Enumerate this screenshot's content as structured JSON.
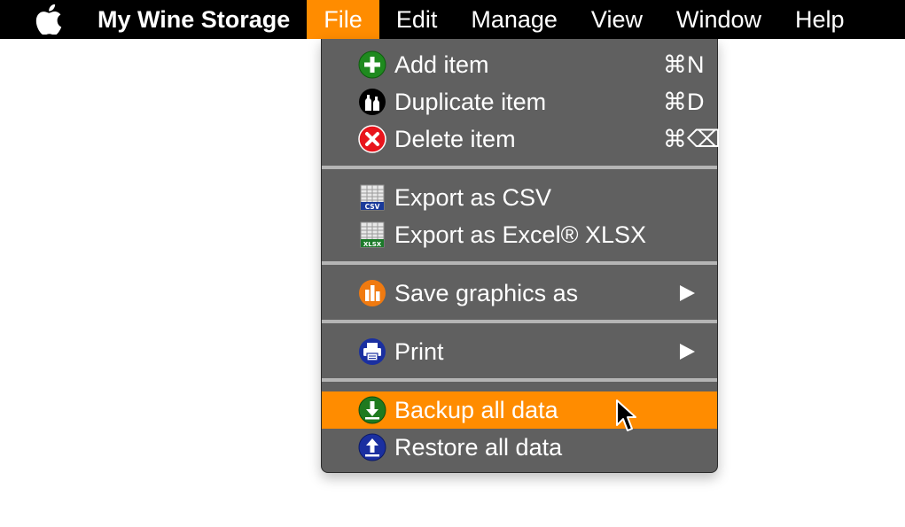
{
  "menubar": {
    "apple_icon": "apple-icon",
    "app_name": "My Wine Storage",
    "items": [
      {
        "label": "File",
        "active": true
      },
      {
        "label": "Edit"
      },
      {
        "label": "Manage"
      },
      {
        "label": "View"
      },
      {
        "label": "Window"
      },
      {
        "label": "Help"
      }
    ]
  },
  "file_menu": {
    "items": [
      {
        "icon": "add-icon",
        "label": "Add item",
        "shortcut": "⌘N"
      },
      {
        "icon": "bottles-icon",
        "label": "Duplicate item",
        "shortcut": "⌘D"
      },
      {
        "icon": "delete-icon",
        "label": "Delete item",
        "shortcut": "⌘⌫"
      },
      {
        "icon": "csv-file-icon",
        "label": "Export as CSV"
      },
      {
        "icon": "xlsx-file-icon",
        "label": "Export as Excel® XLSX"
      },
      {
        "icon": "chart-icon",
        "label": "Save graphics as",
        "submenu": true
      },
      {
        "icon": "printer-icon",
        "label": "Print",
        "submenu": true
      },
      {
        "icon": "download-icon",
        "label": "Backup all data",
        "highlighted": true
      },
      {
        "icon": "upload-icon",
        "label": "Restore all data"
      }
    ],
    "csv_badge": "CSV",
    "xlsx_badge": "XLSX"
  },
  "colors": {
    "menubar_bg": "#000000",
    "accent": "#ff8c00",
    "menu_bg": "#606060",
    "separator": "#b5b5b5",
    "green": "#1f8a1f",
    "red": "#e8141c",
    "blue": "#1a2fa0",
    "orange": "#f07a10"
  }
}
